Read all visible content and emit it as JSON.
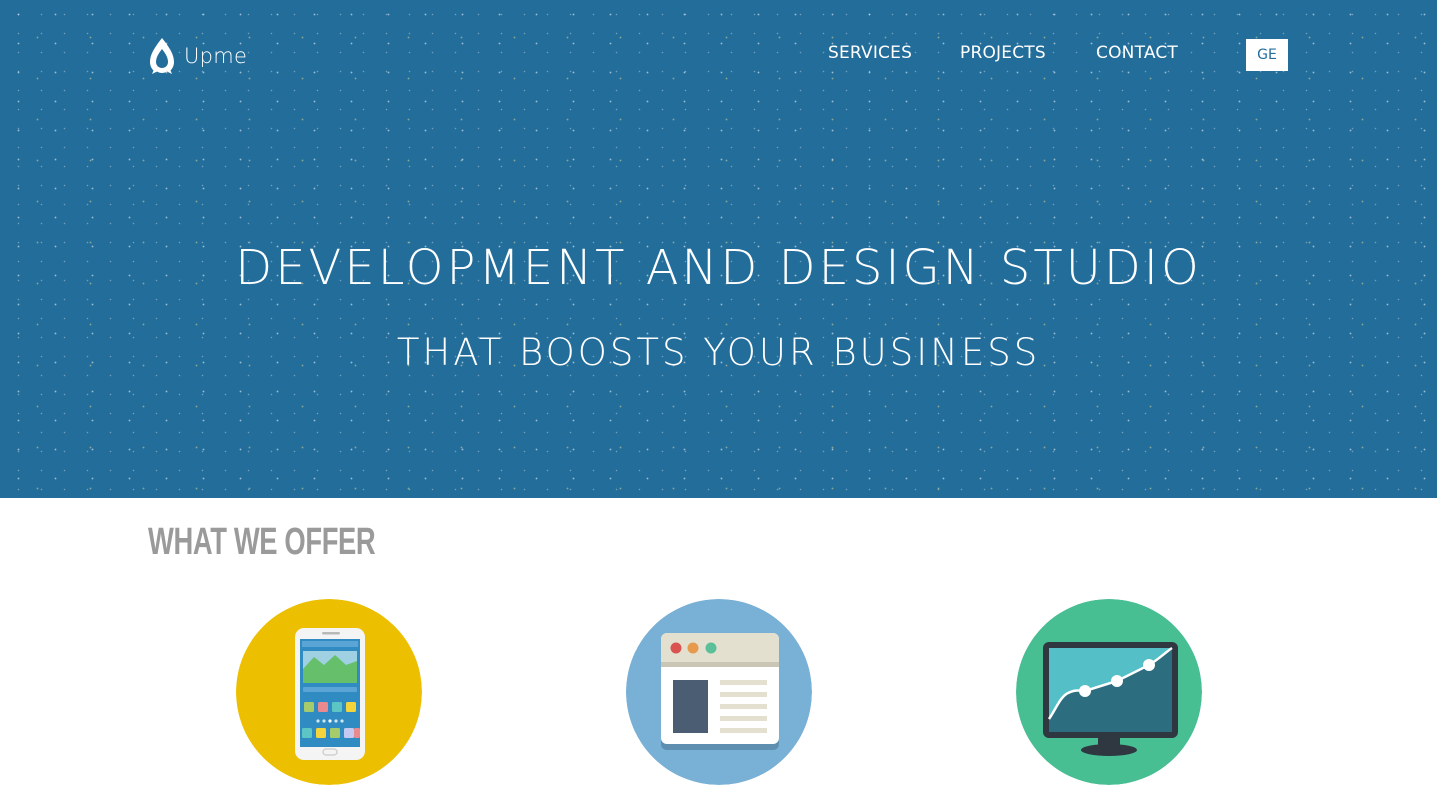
{
  "header": {
    "brand": "Upme",
    "nav": [
      {
        "label": "SERVICES"
      },
      {
        "label": "PROJECTS"
      },
      {
        "label": "CONTACT"
      }
    ],
    "language_button": "GE"
  },
  "hero": {
    "title": "DEVELOPMENT AND DESIGN STUDIO",
    "subtitle": "THAT BOOSTS YOUR BUSINESS"
  },
  "offer": {
    "heading": "WHAT WE OFFER",
    "services": [
      {
        "icon": "mobile-app-icon",
        "color": "#ecbf00"
      },
      {
        "icon": "web-browser-icon",
        "color": "#79b0d6"
      },
      {
        "icon": "analytics-monitor-icon",
        "color": "#48be93"
      }
    ]
  },
  "colors": {
    "hero_background": "#236d9b",
    "heading_gray": "#9a9a9a"
  }
}
